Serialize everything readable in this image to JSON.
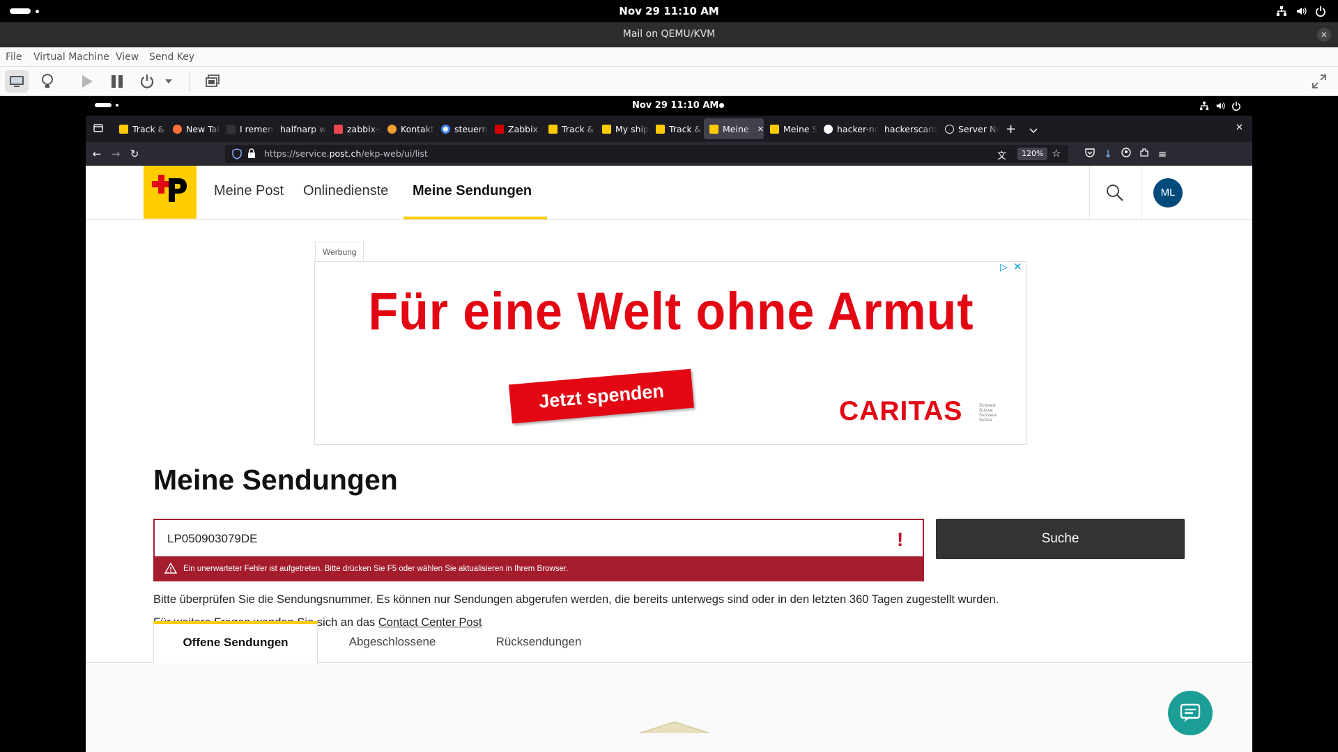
{
  "host": {
    "datetime": "Nov 29  11:10 AM",
    "window_title": "Mail on QEMU/KVM",
    "menu": [
      "File",
      "Virtual Machine",
      "View",
      "Send Key"
    ]
  },
  "guest": {
    "datetime": "Nov 29  11:10 AM"
  },
  "browser": {
    "tabs": [
      {
        "label": "Track & Trace",
        "color": "#ffcc00"
      },
      {
        "label": "New Tab",
        "color": "#ff7139"
      },
      {
        "label": "I remember",
        "color": "#333333"
      },
      {
        "label": "halfnarp web",
        "color": "#1c1b22"
      },
      {
        "label": "zabbix-sn",
        "color": "#e8474f"
      },
      {
        "label": "Kontakt |",
        "color": "#f0a030"
      },
      {
        "label": "steuern v",
        "color": "#4285f4"
      },
      {
        "label": "Zabbix Do",
        "color": "#d40000"
      },
      {
        "label": "Track & Tr",
        "color": "#ffcc00"
      },
      {
        "label": "My shipm",
        "color": "#ffcc00"
      },
      {
        "label": "Track & Tr",
        "color": "#ffcc00"
      },
      {
        "label": "Meine S",
        "color": "#ffcc00",
        "active": true
      },
      {
        "label": "Meine Se",
        "color": "#ffcc00"
      },
      {
        "label": "hacker-no",
        "color": "#ffffff"
      },
      {
        "label": "hackerscard",
        "color": "#1c1b22"
      },
      {
        "label": "Server No",
        "color": "#1c1b22"
      }
    ],
    "url_prefix": "https://service.",
    "url_domain": "post.ch",
    "url_path": "/ekp-web/ui/list",
    "zoom": "120%"
  },
  "site": {
    "nav": [
      "Meine Post",
      "Onlinedienste",
      "Meine Sendungen"
    ],
    "avatar": "ML",
    "ad_label": "Werbung",
    "ad": {
      "headline": "Für eine Welt ohne Armut",
      "cta": "Jetzt spenden",
      "brand": "CARITAS",
      "brand_sub": [
        "Schweiz",
        "Suisse",
        "Svizzera",
        "Svizra"
      ],
      "brand_color": "#e30613"
    },
    "title": "Meine Sendungen",
    "search_value": "LP050903079DE",
    "error_message": "Ein unerwarteter Fehler ist aufgetreten. Bitte drücken Sie F5 oder wählen Sie aktualisieren in Ihrem Browser.",
    "search_button": "Suche",
    "info_line": "Bitte überprüfen Sie die Sendungsnummer. Es können nur Sendungen abgerufen werden, die bereits unterwegs sind oder in den letzten 360 Tagen zugestellt wurden.",
    "contact_prefix": "Für weitere Fragen wenden Sie sich an das ",
    "contact_link": "Contact Center Post",
    "tabs": [
      "Offene Sendungen",
      "Abgeschlossene",
      "Rücksendungen"
    ]
  }
}
